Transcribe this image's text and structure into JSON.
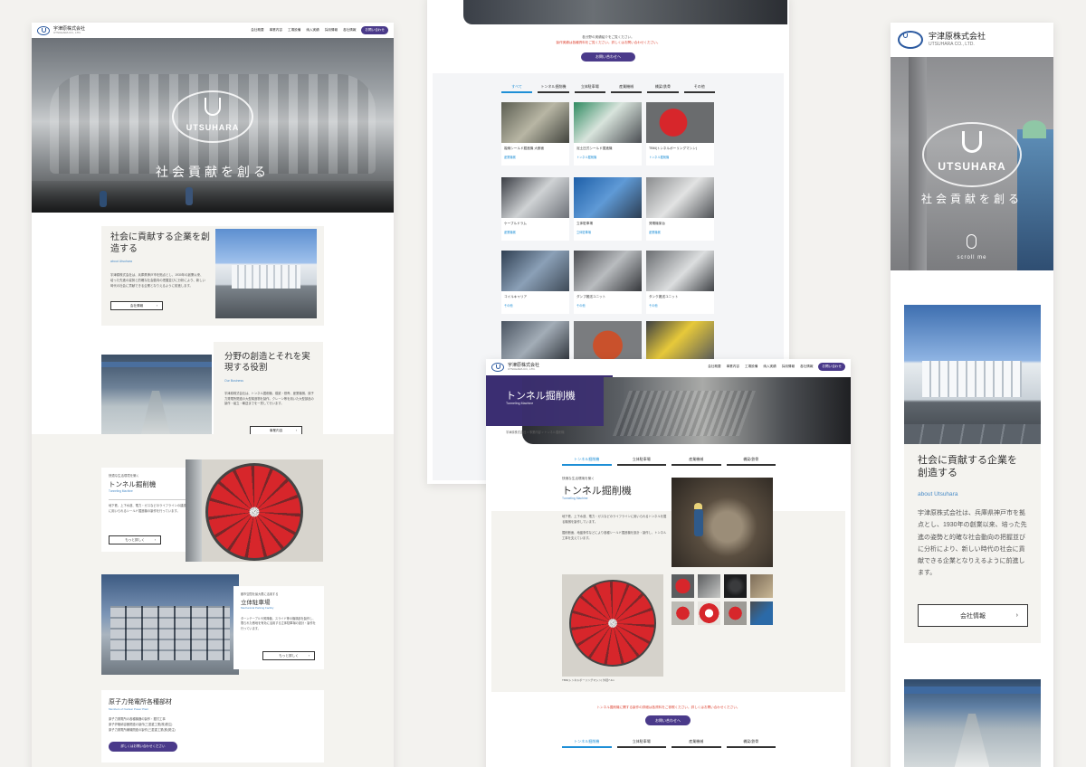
{
  "brand": {
    "name_jp": "宇津原株式会社",
    "name_en": "UTSUHARA CO., LTD.",
    "emblem_text": "UTSUHARA"
  },
  "nav": {
    "items": [
      "会社概要",
      "事業内容",
      "工場設備",
      "納入実績",
      "採用情報",
      "各社情報"
    ],
    "cta": "お問い合わせ"
  },
  "hero": {
    "tagline": "社会貢献を創る"
  },
  "about": {
    "heading": "社会に貢献する企業を創造する",
    "sub": "about Utsuhara",
    "body": "宇津原株式会社は、兵庫県神戸市を拠点とし、1930年の創業以来、培った先進の姿勢と的確な社会動向の把握並びに分析により、新しい時代の社会に貢献できる企業となりえるように前進します。",
    "button": "会社情報"
  },
  "business": {
    "heading": "分野の創造とそれを実現する役割",
    "sub": "Our Business",
    "body": "宇津原株式会社は、トンネル掘削機、橋梁・鉄骨、産業機械、原子力発電所関連の大型構造物を製作。クレーン等を用いた大型部品の製作・組立・輸送までを一貫して行います。",
    "button": "事業内容"
  },
  "tunnel": {
    "kicker": "快適な生活環境を築く",
    "heading": "トンネル掘削機",
    "sub": "Tunneling Machine",
    "body": "地下鉄、上下水道、電力・ガスなどのライフラインの建設に用いられるシールド掘進機の製作を行っています。",
    "button": "もっと詳しく"
  },
  "parking": {
    "kicker": "都市空間を最大限に活用する",
    "heading": "立体駐車場",
    "sub": "Mechanical Parking Facility",
    "body": "ターンテーブルや昇降機、スライド等の機構部を製作し、限られた敷地を有効に活用する立体駐車場の設計・製作を行っています。",
    "button": "もっと詳しく"
  },
  "nuclear": {
    "heading": "原子力発電所各種部材",
    "sub": "Members of Nuclear Power Plant",
    "lines": [
      "原子力発電所の各種機器の製作・据付工事",
      "原子炉格納容器関連の製作(三菱重工業(株)発注)",
      "原子力発電所補機関連の製作(三菱重工業(株)発注)"
    ],
    "button": "詳しくはお問い合わせください"
  },
  "works": {
    "intro": "各分野の実績紹介をご覧ください。",
    "intro_red": "製作実績は各種資料をご覧ください。詳しくはお問い合わせください。",
    "button": "お問い合わせへ",
    "tabs": [
      "すべて",
      "トンネル掘削機",
      "立体駐車場",
      "産業機械",
      "橋梁/鉄骨",
      "その他"
    ],
    "items": [
      {
        "title": "複線シールド掘進機 大断面",
        "cat": "産業機械"
      },
      {
        "title": "泥土圧式シールド掘進機",
        "cat": "トンネル掘削機"
      },
      {
        "title": "TBM(トンネルボーリングマシン)",
        "cat": "トンネル掘削機"
      },
      {
        "title": "ケーブルドラム",
        "cat": "産業機械"
      },
      {
        "title": "立体駐車場",
        "cat": "立体駐車場"
      },
      {
        "title": "発電機架台",
        "cat": "産業機械"
      },
      {
        "title": "コイルキャリア",
        "cat": "その他"
      },
      {
        "title": "ダンプ搬送ユニット",
        "cat": "その他"
      },
      {
        "title": "タンク搬送ユニット",
        "cat": "その他"
      }
    ]
  },
  "detail": {
    "page_title": "トンネル掘削機",
    "page_title_en": "Tunneling Machine",
    "breadcrumb": "宇津原株式会社 > 事業内容 > トンネル掘削機",
    "tabs": [
      "トンネル掘削機",
      "立体駐車場",
      "産業機械",
      "橋梁/鉄骨"
    ],
    "kicker": "快適な生活環境を築く",
    "heading": "トンネル掘削機",
    "sub": "Tunneling Machine",
    "p1": "地下鉄、上下水道、電力・ガスなどのライフラインに用いられるトンネルを掘る機械を製作しています。",
    "p2": "掘削断面、地盤条件などにより各種シールド掘進機を設計・製作し、トンネル工事を支えています。",
    "caption": "TBM(トンネルボーリングマシン) 外径7.4m",
    "note": "トンネル掘削機に関する製作の詳細は各資料をご参照ください。詳しくはお問い合わせください。",
    "button": "お問い合わせへ"
  },
  "mobile": {
    "tagline": "社会貢献を創る",
    "scroll": "scroll me",
    "heading": "社会に貢献する企業を創造する",
    "sub": "about Utsuhara",
    "body": "宇津原株式会社は、兵庫県神戸市を拠点とし、1930年の創業以来、培った先進の姿勢と的確な社会動向の把握並びに分析により、新しい時代の社会に貢献できる企業となりえるように前進します。",
    "button": "会社情報"
  },
  "colors": {
    "accent": "#4a3a8a",
    "link": "#1e8fd6",
    "panel": "#f4f3ef",
    "bg": "#f3f2ef",
    "drum_red": "#d7262b"
  }
}
